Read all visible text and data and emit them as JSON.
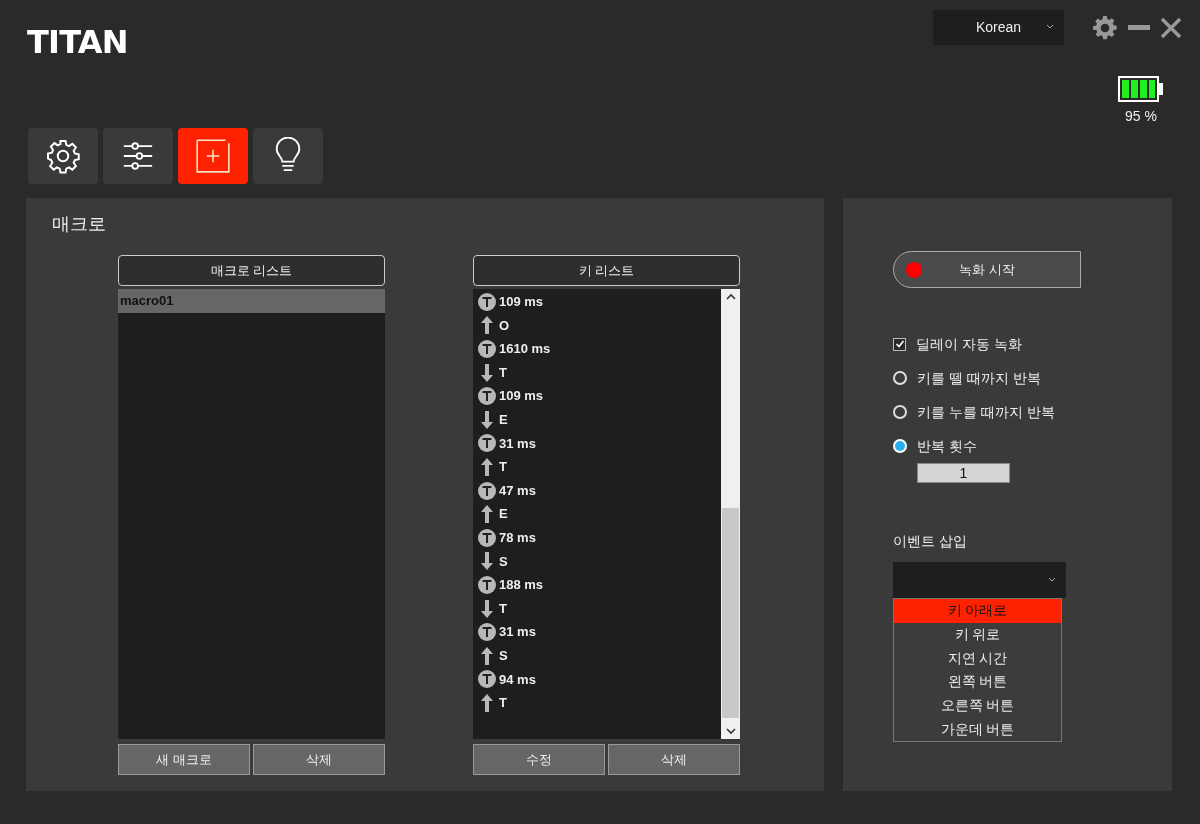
{
  "logo": "TITAN",
  "language": {
    "value": "Korean"
  },
  "battery": {
    "reading": "95 %"
  },
  "tabs": [
    {
      "kind": "settings",
      "selected": false
    },
    {
      "kind": "sliders",
      "selected": false
    },
    {
      "kind": "macro",
      "selected": true
    },
    {
      "kind": "lighting",
      "selected": false
    }
  ],
  "macro_panel": {
    "title": "매크로",
    "macro_list": {
      "header": "매크로 리스트",
      "items": [
        {
          "label": "macro01",
          "selected": true
        }
      ],
      "buttons": [
        "새 매크로",
        "삭제"
      ]
    },
    "key_list": {
      "header": "키 리스트",
      "items": [
        {
          "kind": "delay",
          "label": "109 ms"
        },
        {
          "kind": "up",
          "label": "O"
        },
        {
          "kind": "delay",
          "label": "1610 ms"
        },
        {
          "kind": "down",
          "label": "T"
        },
        {
          "kind": "delay",
          "label": "109 ms"
        },
        {
          "kind": "down",
          "label": "E"
        },
        {
          "kind": "delay",
          "label": "31 ms"
        },
        {
          "kind": "up",
          "label": "T"
        },
        {
          "kind": "delay",
          "label": "47 ms"
        },
        {
          "kind": "up",
          "label": "E"
        },
        {
          "kind": "delay",
          "label": "78 ms"
        },
        {
          "kind": "down",
          "label": "S"
        },
        {
          "kind": "delay",
          "label": "188 ms"
        },
        {
          "kind": "down",
          "label": "T"
        },
        {
          "kind": "delay",
          "label": "31 ms"
        },
        {
          "kind": "up",
          "label": "S"
        },
        {
          "kind": "delay",
          "label": "94 ms"
        },
        {
          "kind": "up",
          "label": "T"
        }
      ],
      "buttons": [
        "수정",
        "삭제"
      ]
    }
  },
  "record_panel": {
    "record_button": "녹화 시작",
    "options": [
      {
        "kind": "checkbox",
        "label": "딜레이 자동 녹화",
        "checked": true
      },
      {
        "kind": "radio",
        "label": "키를 뗄 때까지 반복",
        "selected": false
      },
      {
        "kind": "radio",
        "label": "키를 누를 때까지 반복",
        "selected": false
      },
      {
        "kind": "radio",
        "label": "반복 횟수",
        "selected": true
      }
    ],
    "repeat_count": {
      "value": "1"
    },
    "event_insert": {
      "label": "이벤트 삽입",
      "options": [
        {
          "label": "키 아래로",
          "selected": true
        },
        {
          "label": "키 위로",
          "selected": false
        },
        {
          "label": "지연 시간",
          "selected": false
        },
        {
          "label": "왼쪽 버튼",
          "selected": false
        },
        {
          "label": "오른쪽 버튼",
          "selected": false
        },
        {
          "label": "가운데 버튼",
          "selected": false
        }
      ]
    }
  }
}
